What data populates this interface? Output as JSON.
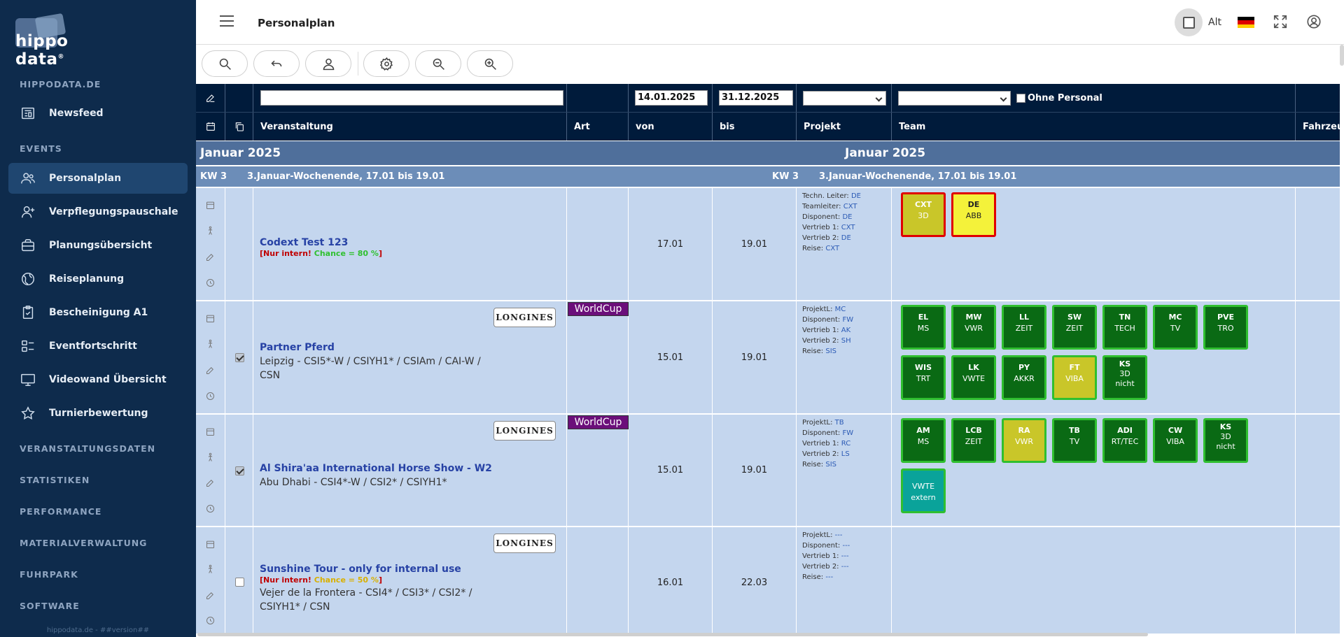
{
  "sidebar": {
    "logo": "hippo data",
    "logo_mark": "®",
    "sections": {
      "hippodata": "HIPPODATA.DE",
      "events": "EVENTS",
      "veranstaltungsdaten": "VERANSTALTUNGSDATEN",
      "statistiken": "STATISTIKEN",
      "performance": "PERFORMANCE",
      "materialverwaltung": "MATERIALVERWALTUNG",
      "fuhrpark": "FUHRPARK",
      "software": "SOFTWARE"
    },
    "items": {
      "newsfeed": "Newsfeed",
      "personalplan": "Personalplan",
      "verpflegung": "Verpflegungspauschale",
      "planung": "Planungsübersicht",
      "reise": "Reiseplanung",
      "bescheinigung": "Bescheinigung A1",
      "eventfortschritt": "Eventfortschritt",
      "videowand": "Videowand Übersicht",
      "turnier": "Turnierbewertung"
    },
    "version": "hippodata.de - ##version##"
  },
  "topbar": {
    "title": "Personalplan",
    "alt_label": "Alt"
  },
  "filters": {
    "von": "14.01.2025",
    "bis": "31.12.2025",
    "ohne_personal": "Ohne Personal"
  },
  "columns": {
    "veranstaltung": "Veranstaltung",
    "art": "Art",
    "von": "von",
    "bis": "bis",
    "projekt": "Projekt",
    "team": "Team",
    "fahrzeug": "Fahrzeu"
  },
  "month": "Januar 2025",
  "week": {
    "kw": "KW 3",
    "label": "3.Januar-Wochenende, 17.01 bis 19.01"
  },
  "rows": [
    {
      "title": "Codext Test 123",
      "note_red": "[Nur intern!",
      "note_chance": "Chance = 80 %",
      "note_close": "]",
      "von": "17.01",
      "bis": "19.01",
      "info": [
        {
          "k": "Techn. Leiter:",
          "v": "DE"
        },
        {
          "k": "Teamleiter:",
          "v": "CXT"
        },
        {
          "k": "Disponent:",
          "v": "DE"
        },
        {
          "k": "Vertrieb 1:",
          "v": "CXT"
        },
        {
          "k": "Vertrieb 2:",
          "v": "DE"
        },
        {
          "k": "Reise:",
          "v": "CXT"
        }
      ],
      "tiles": [
        {
          "a": "CXT",
          "b": "3D",
          "style": "yellowred"
        },
        {
          "a": "DE",
          "b": "ABB",
          "style": "brightred"
        }
      ]
    },
    {
      "title": "Partner Pferd",
      "sub": "Leipzig - CSI5*-W / CSIYH1* / CSIAm / CAI-W / CSN",
      "sponsor": "LONGINES",
      "art": "WorldCup",
      "von": "15.01",
      "bis": "19.01",
      "info": [
        {
          "k": "ProjektL:",
          "v": "MC"
        },
        {
          "k": "Disponent:",
          "v": "FW"
        },
        {
          "k": "Vertrieb 1:",
          "v": "AK"
        },
        {
          "k": "Vertrieb 2:",
          "v": "SH"
        },
        {
          "k": "Reise:",
          "v": "SIS"
        }
      ],
      "tiles": [
        {
          "a": "EL",
          "b": "MS",
          "style": "green"
        },
        {
          "a": "MW",
          "b": "VWR",
          "style": "green"
        },
        {
          "a": "LL",
          "b": "ZEIT",
          "style": "green"
        },
        {
          "a": "SW",
          "b": "ZEIT",
          "style": "green"
        },
        {
          "a": "TN",
          "b": "TECH",
          "style": "green"
        },
        {
          "a": "MC",
          "b": "TV",
          "style": "green"
        },
        {
          "a": "PVE",
          "b": "TRO",
          "style": "green"
        },
        {
          "a": "WIS",
          "b": "TRT",
          "style": "green"
        },
        {
          "a": "LK",
          "b": "VWTE",
          "style": "green"
        },
        {
          "a": "PY",
          "b": "AKKR",
          "style": "green"
        },
        {
          "a": "FT",
          "b": "VIBA",
          "style": "yellowgreen"
        },
        {
          "a": "KS",
          "b": "3D",
          "c": "nicht",
          "style": "green"
        }
      ]
    },
    {
      "title": "Al Shira'aa International Horse Show - W2",
      "sub": "Abu Dhabi - CSI4*-W / CSI2* / CSIYH1*",
      "sponsor": "LONGINES",
      "art": "WorldCup",
      "von": "15.01",
      "bis": "19.01",
      "info": [
        {
          "k": "ProjektL:",
          "v": "TB"
        },
        {
          "k": "Disponent:",
          "v": "FW"
        },
        {
          "k": "Vertrieb 1:",
          "v": "RC"
        },
        {
          "k": "Vertrieb 2:",
          "v": "LS"
        },
        {
          "k": "Reise:",
          "v": "SIS"
        }
      ],
      "tiles": [
        {
          "a": "AM",
          "b": "MS",
          "style": "green"
        },
        {
          "a": "LCB",
          "b": "ZEIT",
          "style": "green"
        },
        {
          "a": "RA",
          "b": "VWR",
          "style": "yellowgreen"
        },
        {
          "a": "TB",
          "b": "TV",
          "style": "green"
        },
        {
          "a": "ADI",
          "b": "RT/TEC",
          "style": "green"
        },
        {
          "a": "CW",
          "b": "VIBA",
          "style": "green"
        },
        {
          "a": "KS",
          "b": "3D",
          "c": "nicht",
          "style": "green"
        },
        {
          "a": "VWTE",
          "b": "extern",
          "style": "teal"
        }
      ]
    },
    {
      "title": "Sunshine Tour - only for internal use",
      "note_red": "[Nur intern!",
      "note_chance": "Chance = 50 %",
      "note_close": "]",
      "sub": "Vejer de la Frontera - CSI4* / CSI3* / CSI2* / CSIYH1* / CSN",
      "sponsor": "LONGINES",
      "von": "16.01",
      "bis": "22.03",
      "info": [
        {
          "k": "ProjektL:",
          "v": "---"
        },
        {
          "k": "Disponent:",
          "v": "---"
        },
        {
          "k": "Vertrieb 1:",
          "v": "---"
        },
        {
          "k": "Vertrieb 2:",
          "v": "---"
        },
        {
          "k": "Reise:",
          "v": "---"
        }
      ],
      "tiles": []
    }
  ],
  "colors": {
    "sidebar": "#0e2b4c",
    "header": "#001b3b",
    "row": "#c4d6ee"
  }
}
